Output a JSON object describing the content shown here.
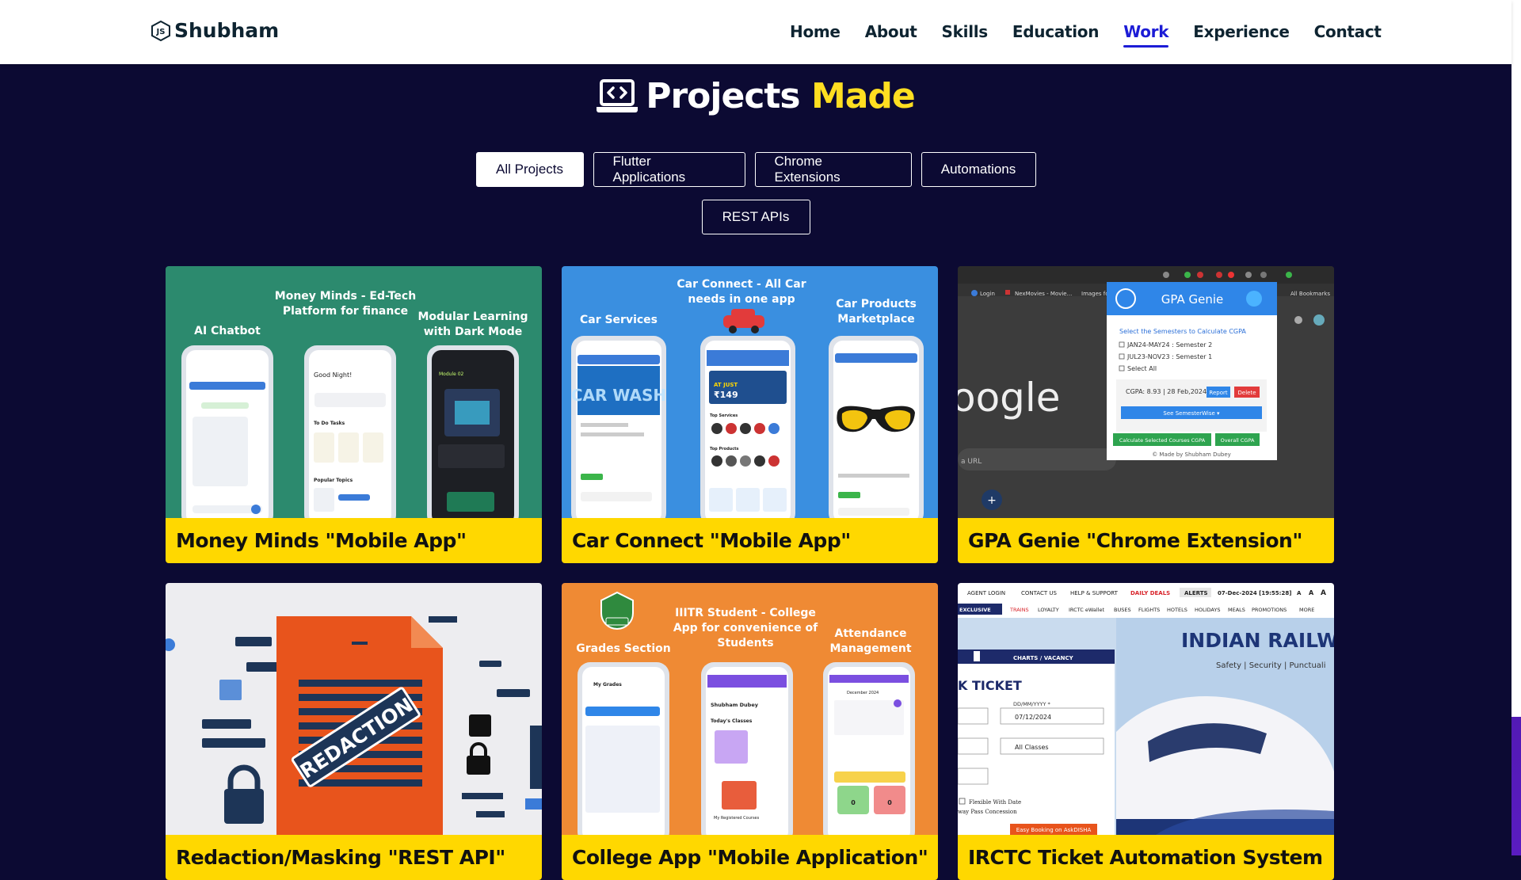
{
  "brand": {
    "name": "Shubham"
  },
  "nav": [
    {
      "label": "Home"
    },
    {
      "label": "About"
    },
    {
      "label": "Skills"
    },
    {
      "label": "Education"
    },
    {
      "label": "Work",
      "active": true
    },
    {
      "label": "Experience"
    },
    {
      "label": "Contact"
    }
  ],
  "heading": {
    "part1": "Projects",
    "part2": "Made"
  },
  "filters": [
    "All Projects",
    "Flutter Applications",
    "Chrome Extensions",
    "Automations",
    "REST APIs"
  ],
  "active_filter": "All Projects",
  "projects": [
    {
      "title": "Money Minds \"Mobile App\"",
      "image": {
        "background": "#2c8a6e",
        "center_caption": "Money Minds - Ed-Tech Platform for finance",
        "left_caption": "AI Chatbot",
        "right_caption": "Modular Learning with Dark Mode",
        "phone_texts": [
          "Good Night!",
          "To Do Tasks",
          "Popular Topics",
          "Module 02"
        ]
      }
    },
    {
      "title": "Car Connect \"Mobile App\"",
      "image": {
        "background": "#3a8fe0",
        "center_caption": "Car Connect - All Car needs in one app",
        "left_caption": "Car Services",
        "right_caption": "Car Products Marketplace",
        "phone_texts": [
          "CAR WASH",
          "AT JUST ₹149",
          "Top Services",
          "Top Products"
        ]
      }
    },
    {
      "title": "GPA Genie \"Chrome Extension\"",
      "image": {
        "background": "#3c3c3c",
        "popup_title": "GPA Genie",
        "popup_prompt": "Select the Semesters to Calculate CGPA",
        "semesters": [
          "JAN24-MAY24 : Semester 2",
          "JUL23-NOV23 : Semester 1",
          "Select All"
        ],
        "result": "CGPA: 8.93 | 28 Feb,2024",
        "buttons": [
          "Report",
          "Delete",
          "See SemesterWise ▾",
          "Calculate Selected Courses CGPA",
          "Overall CGPA"
        ],
        "footer": "© Made by Shubham Dubey",
        "bookmarks": [
          "Login",
          "NexMovies - Movie...",
          "Images fo",
          "All Bookmarks"
        ],
        "search_text": "oogle",
        "url_hint": "a URL"
      }
    },
    {
      "title": "Redaction/Masking \"REST API\"",
      "image": {
        "background": "#ededf0",
        "stamp": "REDACTION"
      }
    },
    {
      "title": "College App \"Mobile Application\"",
      "image": {
        "background": "#ef8a34",
        "center_caption": "IIITR Student - College App for convenience of Students",
        "left_caption": "Grades Section",
        "right_caption": "Attendance Management",
        "phone_texts": [
          "My Grades",
          "Shubham Dubey",
          "Today's Classes",
          "My Registered Courses",
          "December 2024"
        ]
      }
    },
    {
      "title": "IRCTC Ticket Automation System",
      "image": {
        "background": "#ffffff",
        "topbar": [
          "AGENT LOGIN",
          "CONTACT US",
          "HELP & SUPPORT",
          "DAILY DEALS",
          "ALERTS",
          "07-Dec-2024 [19:55:28]",
          "A",
          "A",
          "A"
        ],
        "menu": [
          "EXCLUSIVE",
          "TRAINS",
          "LOYALTY",
          "IRCTC eWallet",
          "BUSES",
          "FLIGHTS",
          "HOTELS",
          "HOLIDAYS",
          "MEALS",
          "PROMOTIONS",
          "MORE"
        ],
        "banner_title": "INDIAN RAILW",
        "banner_sub": "Safety | Security | Punctuali",
        "form_title": "K TICKET",
        "charts": "CHARTS / VACANCY",
        "date_label": "DD/MM/YYYY *",
        "date_value": "07/12/2024",
        "class_value": "All Classes",
        "checkbox1": "Flexible With Date",
        "checkbox2": "way Pass Concession",
        "disha": "Easy Booking on AskDISHA"
      }
    }
  ]
}
